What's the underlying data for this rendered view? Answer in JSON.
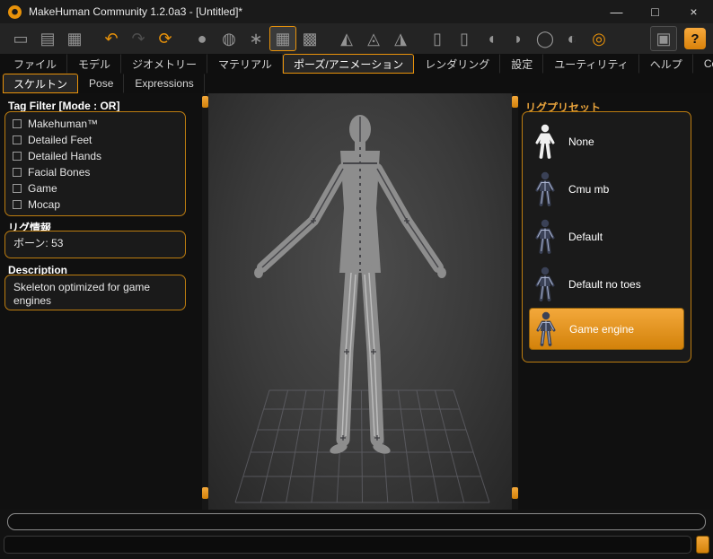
{
  "colors": {
    "accent": "#e8920a",
    "panel_border": "#bd7d10",
    "selection": "#e89a22"
  },
  "window": {
    "title": "MakeHuman Community 1.2.0a3 - [Untitled]*",
    "minimize": "—",
    "maximize": "□",
    "close": "×"
  },
  "toolbar": {
    "icons": [
      {
        "name": "new-file-icon",
        "glyph": "▭"
      },
      {
        "name": "save-icon",
        "glyph": "▤"
      },
      {
        "name": "load-icon",
        "glyph": "▦"
      },
      {
        "name": "undo-icon",
        "glyph": "↶"
      },
      {
        "name": "redo-icon",
        "glyph": "↷"
      },
      {
        "name": "reload-icon",
        "glyph": "⟳"
      },
      {
        "name": "smooth-shaded-icon",
        "glyph": "●"
      },
      {
        "name": "wireframe-icon",
        "glyph": "◍"
      },
      {
        "name": "skeleton-view-icon",
        "glyph": "∗"
      },
      {
        "name": "pose-grid-icon",
        "glyph": "▦"
      },
      {
        "name": "texture-checker-icon",
        "glyph": "▩"
      },
      {
        "name": "symmetry-left-icon",
        "glyph": "◭"
      },
      {
        "name": "symmetry-both-icon",
        "glyph": "◬"
      },
      {
        "name": "symmetry-right-icon",
        "glyph": "◮"
      },
      {
        "name": "mouse-rotate-icon",
        "glyph": "▯"
      },
      {
        "name": "mouse-pan-icon",
        "glyph": "▯"
      },
      {
        "name": "rotate-left-icon",
        "glyph": "◖"
      },
      {
        "name": "rotate-right-icon",
        "glyph": "◗"
      },
      {
        "name": "top-view-icon",
        "glyph": "◯"
      },
      {
        "name": "side-view-icon",
        "glyph": "◐"
      },
      {
        "name": "reset-camera-icon",
        "glyph": "◎"
      },
      {
        "name": "screenshot-icon",
        "glyph": "▣"
      },
      {
        "name": "help-icon",
        "glyph": "?"
      }
    ]
  },
  "menu_tabs": [
    "ファイル",
    "モデル",
    "ジオメトリー",
    "マテリアル",
    "ポーズ/アニメーション",
    "レンダリング",
    "設定",
    "ユーティリティ",
    "ヘルプ",
    "Community"
  ],
  "sub_tabs": [
    "スケルトン",
    "Pose",
    "Expressions"
  ],
  "left_panel": {
    "tag_filter": {
      "title": "Tag Filter [Mode : OR]",
      "items": [
        "Makehuman™",
        "Detailed Feet",
        "Detailed Hands",
        "Facial Bones",
        "Game",
        "Mocap"
      ]
    },
    "rig_info": {
      "title": "リグ情報",
      "bones": "ボーン: 53"
    },
    "description": {
      "title": "Description",
      "text": "Skeleton optimized for game engines"
    }
  },
  "right_panel": {
    "title": "リグプリセット",
    "items": [
      "None",
      "Cmu mb",
      "Default",
      "Default no toes",
      "Game engine"
    ],
    "selected": "Game engine"
  }
}
